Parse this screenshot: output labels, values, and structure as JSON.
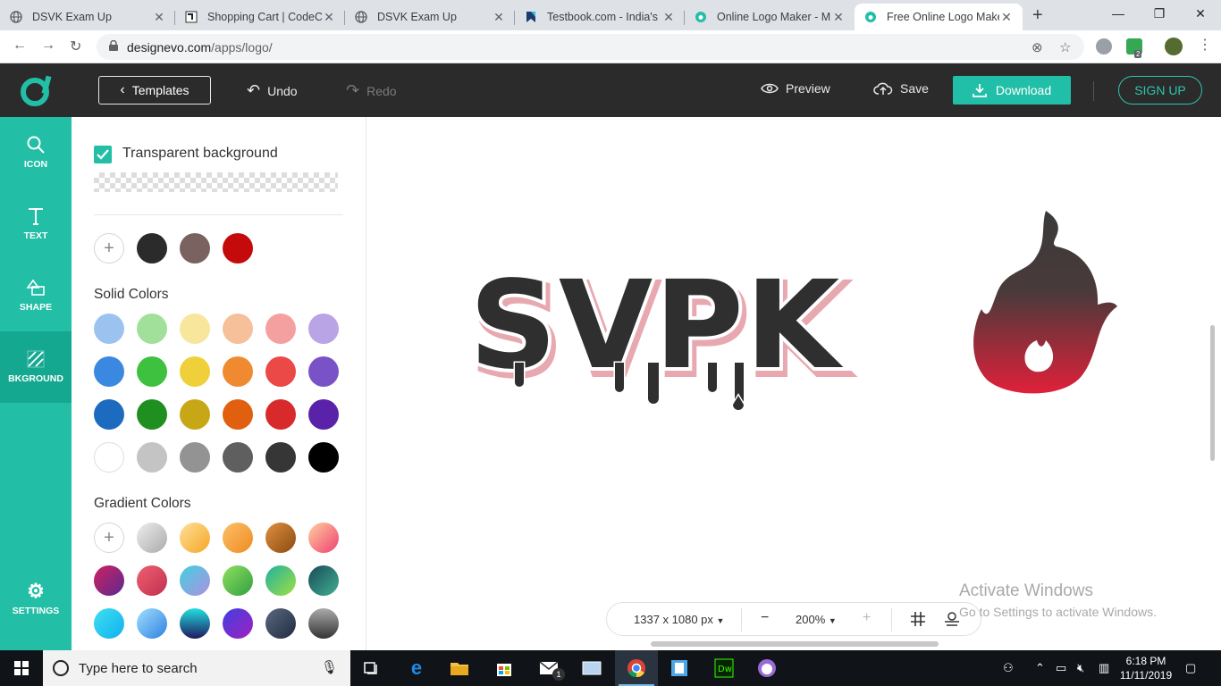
{
  "browser": {
    "tabs": [
      {
        "title": "DSVK Exam Up",
        "favicon": "globe-icon"
      },
      {
        "title": "Shopping Cart | CodeCa",
        "favicon": "codecanyon-icon"
      },
      {
        "title": "DSVK Exam Up",
        "favicon": "globe-icon"
      },
      {
        "title": "Testbook.com - India's I",
        "favicon": "testbook-icon"
      },
      {
        "title": "Online Logo Maker - M",
        "favicon": "designevo-icon"
      },
      {
        "title": "Free Online Logo Make",
        "favicon": "designevo-icon",
        "active": true
      }
    ],
    "url_domain": "designevo.com",
    "url_path": "/apps/logo/",
    "extension_badge": "2"
  },
  "header": {
    "templates_label": "Templates",
    "undo_label": "Undo",
    "redo_label": "Redo",
    "preview_label": "Preview",
    "save_label": "Save",
    "download_label": "Download",
    "signup_label": "SIGN UP"
  },
  "rail": {
    "items": [
      {
        "label": "ICON",
        "icon": "search-icon"
      },
      {
        "label": "TEXT",
        "icon": "text-icon"
      },
      {
        "label": "SHAPE",
        "icon": "shape-icon"
      },
      {
        "label": "BKGROUND",
        "icon": "background-icon",
        "active": true
      }
    ],
    "settings_label": "SETTINGS"
  },
  "panel": {
    "transparent_label": "Transparent background",
    "transparent_checked": true,
    "recent_colors": [
      "#2b2b2b",
      "#7a6260",
      "#c40a0a"
    ],
    "solid_title": "Solid Colors",
    "solid_colors": [
      [
        "#9cc3f0",
        "#a0e09a",
        "#f7e69c",
        "#f5c09a",
        "#f5a0a0",
        "#b9a4e6"
      ],
      [
        "#3a88e0",
        "#3ec13e",
        "#efd03a",
        "#f08a30",
        "#eb4848",
        "#7a52c8"
      ],
      [
        "#1c6bbf",
        "#1f8f1f",
        "#c8a717",
        "#e06010",
        "#d82a2a",
        "#5a22a8"
      ],
      [
        "#ffffff",
        "#c4c4c4",
        "#939393",
        "#5f5f5f",
        "#363636",
        "#000000"
      ]
    ],
    "gradient_title": "Gradient Colors"
  },
  "canvas": {
    "logo_text": "SVPK",
    "size_label": "1337 x 1080 px",
    "zoom_label": "200%",
    "watermark_title": "Activate Windows",
    "watermark_sub": "Go to Settings to activate Windows."
  },
  "taskbar": {
    "search_placeholder": "Type here to search",
    "time": "6:18 PM",
    "date": "11/11/2019",
    "mail_badge": "1"
  }
}
